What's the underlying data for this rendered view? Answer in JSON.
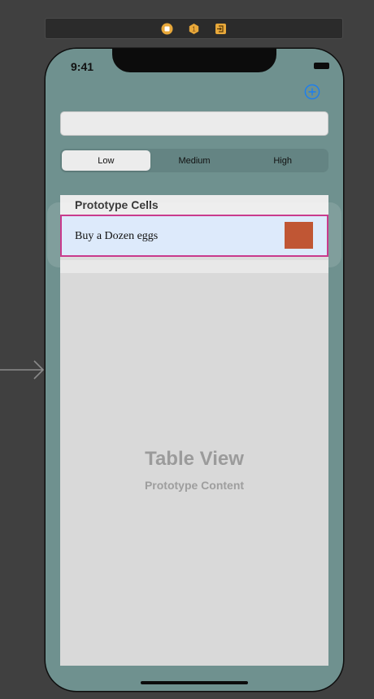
{
  "toolbar": {
    "icons": [
      "view-controller-icon",
      "first-responder-icon",
      "exit-icon"
    ],
    "colors": {
      "accent": "#e8a83a"
    }
  },
  "device": {
    "time": "9:41"
  },
  "nav": {
    "add_icon": "plus-circle-icon",
    "tint": "#1a7ef2"
  },
  "search": {
    "value": "",
    "placeholder": ""
  },
  "segments": {
    "options": [
      "Low",
      "Medium",
      "High"
    ],
    "selected": "Low"
  },
  "table": {
    "section_title": "Prototype Cells",
    "cell": {
      "label": "Buy a Dozen eggs",
      "swatch_color": "#c05634"
    },
    "placeholder_title": "Table View",
    "placeholder_subtitle": "Prototype Content"
  }
}
